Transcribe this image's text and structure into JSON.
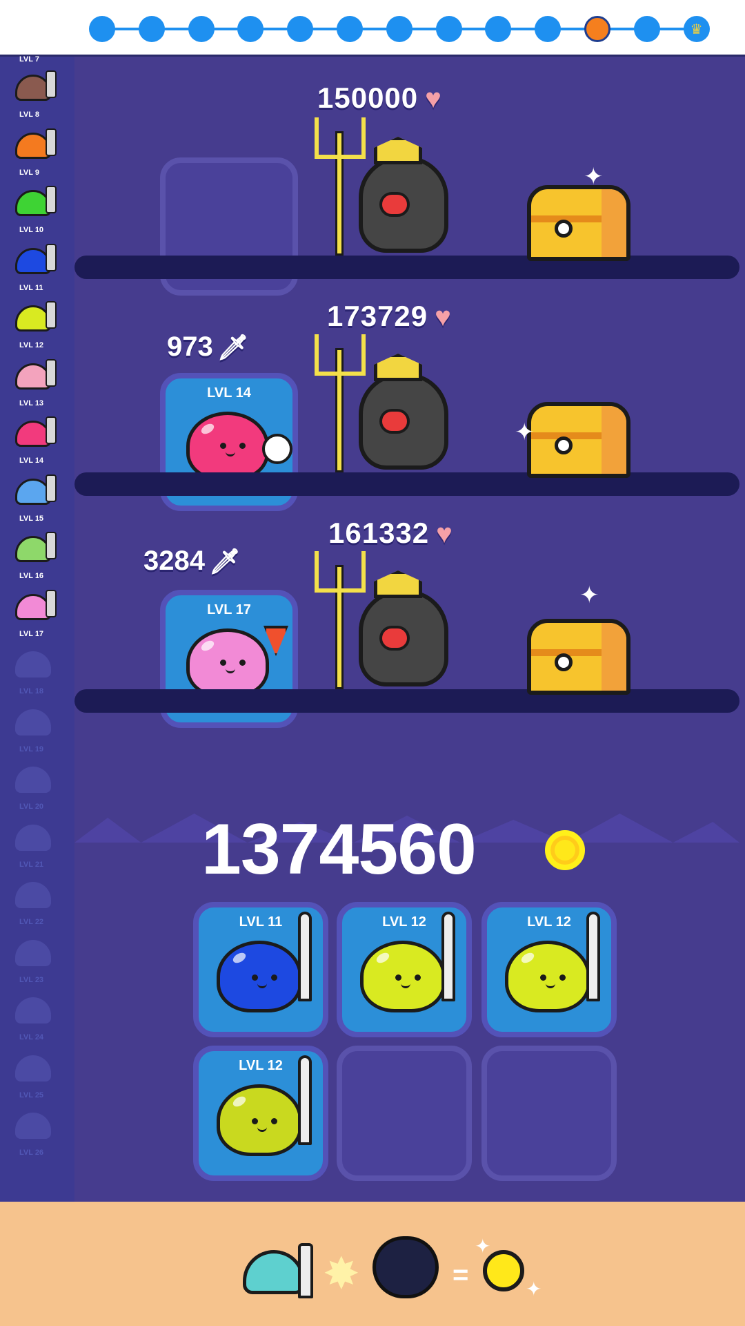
{
  "progress_track": {
    "stages_total": 13,
    "current_stage_index": 11,
    "current_icon": "orange-slime-face-icon",
    "final_icon": "crown-icon"
  },
  "sidebar": {
    "items": [
      {
        "label": "LVL 7",
        "color": "",
        "weapon": "",
        "locked": false
      },
      {
        "label": "LVL 8",
        "color": "#8a5a4f",
        "weapon": "brown-mace",
        "locked": false
      },
      {
        "label": "LVL 9",
        "color": "#f47a1f",
        "weapon": "green-blade",
        "locked": false
      },
      {
        "label": "LVL 10",
        "color": "#3ed334",
        "weapon": "arrow",
        "locked": false
      },
      {
        "label": "LVL 11",
        "color": "#1d49e1",
        "weapon": "twin-daggers",
        "locked": false
      },
      {
        "label": "LVL 12",
        "color": "#d9ea21",
        "weapon": "sword",
        "locked": false
      },
      {
        "label": "LVL 13",
        "color": "#f3a3bd",
        "weapon": "nunchucks",
        "locked": false
      },
      {
        "label": "LVL 14",
        "color": "#f23a7d",
        "weapon": "skull-staff",
        "locked": false
      },
      {
        "label": "LVL 15",
        "color": "#5ba6ef",
        "weapon": "battle-axe",
        "locked": false
      },
      {
        "label": "LVL 16",
        "color": "#8ed86a",
        "weapon": "moon",
        "locked": false
      },
      {
        "label": "LVL 17",
        "color": "#f28ad6",
        "weapon": "dart",
        "locked": false
      },
      {
        "label": "LVL 18",
        "locked": true
      },
      {
        "label": "LVL 19",
        "locked": true
      },
      {
        "label": "LVL 20",
        "locked": true
      },
      {
        "label": "LVL 21",
        "locked": true
      },
      {
        "label": "LVL 22",
        "locked": true
      },
      {
        "label": "LVL 23",
        "locked": true
      },
      {
        "label": "LVL 24",
        "locked": true
      },
      {
        "label": "LVL 25",
        "locked": true
      },
      {
        "label": "LVL 26",
        "locked": true
      }
    ]
  },
  "battle_rows": [
    {
      "boss_hp": "150000",
      "attack": "",
      "slime": null
    },
    {
      "boss_hp": "173729",
      "attack": "973",
      "slime": {
        "label": "LVL 14",
        "color": "#f23a7d"
      }
    },
    {
      "boss_hp": "161332",
      "attack": "3284",
      "slime": {
        "label": "LVL 17",
        "color": "#f28ad6"
      }
    }
  ],
  "coins": {
    "amount": "1374560"
  },
  "inventory": [
    {
      "label": "LVL 11",
      "color": "#1d49e1"
    },
    {
      "label": "LVL 12",
      "color": "#d9ea21"
    },
    {
      "label": "LVL 12",
      "color": "#d9ea21"
    },
    {
      "label": "LVL 12",
      "color": "#c9d91f"
    },
    {
      "label": "",
      "color": ""
    },
    {
      "label": "",
      "color": ""
    }
  ],
  "footer": {
    "equation": [
      "slime-with-sword-icon",
      "impact-burst-icon",
      "bomb-boss-icon",
      "=",
      "coin-icon"
    ],
    "equals": "="
  },
  "colors": {
    "background": "#463c8e",
    "sidebar": "#3d3a92",
    "shelf": "#1c1b55",
    "heart": "#f5a0a7",
    "coin": "#ffe81a",
    "footer": "#f6c38d"
  }
}
